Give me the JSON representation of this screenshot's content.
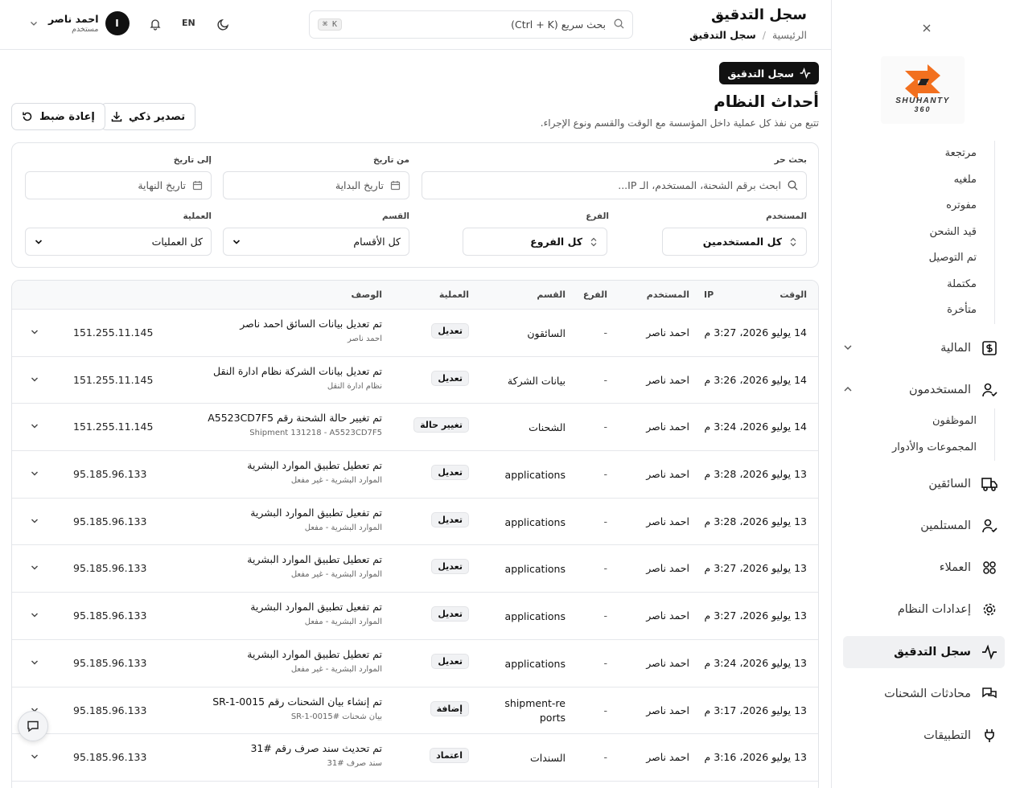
{
  "colors": {
    "accent": "#111111",
    "logo_orange": "#f2701f"
  },
  "sidebar": {
    "close_icon": "close-icon",
    "logo_text_line1": "SHUHANTY",
    "logo_text_line2": "360",
    "shipment_statuses": [
      "مرتجعة",
      "ملغيه",
      "مفوتره",
      "قيد الشحن",
      "تم التوصيل",
      "مكتملة",
      "متأخرة"
    ],
    "finance_label": "المالية",
    "users_label": "المستخدمون",
    "users_sub": [
      "الموظفون",
      "المجموعات والأدوار"
    ],
    "drivers_label": "السائقين",
    "receivers_label": "المستلمين",
    "clients_label": "العملاء",
    "settings_label": "إعدادات النظام",
    "audit_label": "سجل التدقيق",
    "conversations_label": "محادثات الشحنات",
    "apps_label": "التطبيقات"
  },
  "topbar": {
    "title": "سجل التدقيق",
    "breadcrumb_home": "الرئيسية",
    "breadcrumb_sep": "/",
    "breadcrumb_current": "سجل التدقيق",
    "search_placeholder": "بحث سريع (Ctrl + K)",
    "search_kbd": "⌘ K",
    "lang": "EN",
    "user_name": "احمد ناصر",
    "user_role": "مستخدم",
    "user_initial": "I"
  },
  "header": {
    "badge": "سجل التدقيق",
    "title": "أحداث النظام",
    "subtitle": "تتبع من نفذ كل عملية داخل المؤسسة مع الوقت والقسم ونوع الإجراء.",
    "export_label": "تصدير ذكي",
    "reset_label": "إعادة ضبط"
  },
  "filters": {
    "search_label": "بحث حر",
    "search_placeholder": "ابحث برقم الشحنة، المستخدم، الـ IP...",
    "from_label": "من تاريخ",
    "from_placeholder": "تاريخ البداية",
    "to_label": "إلى تاريخ",
    "to_placeholder": "تاريخ النهاية",
    "user_label": "المستخدم",
    "user_value": "كل المستخدمين",
    "branch_label": "الفرع",
    "branch_value": "كل الفروع",
    "dept_label": "القسم",
    "dept_value": "كل الأقسام",
    "op_label": "العملية",
    "op_value": "كل العمليات"
  },
  "table": {
    "headers": {
      "time": "الوقت",
      "user": "المستخدم",
      "branch": "الفرع",
      "dept": "القسم",
      "op": "العملية",
      "desc": "الوصف",
      "ip": "IP"
    },
    "rows": [
      {
        "time": "14 يوليو 2026، 3:27 م",
        "user": "احمد ناصر",
        "branch": "-",
        "dept": "السائقون",
        "op": "تعديل",
        "desc": "تم تعديل بيانات السائق احمد ناصر",
        "sub": "احمد ناصر",
        "ip": "151.255.11.145"
      },
      {
        "time": "14 يوليو 2026، 3:26 م",
        "user": "احمد ناصر",
        "branch": "-",
        "dept": "بيانات الشركة",
        "op": "تعديل",
        "desc": "تم تعديل بيانات الشركة نظام ادارة النقل",
        "sub": "نظام ادارة النقل",
        "ip": "151.255.11.145"
      },
      {
        "time": "14 يوليو 2026، 3:24 م",
        "user": "احمد ناصر",
        "branch": "-",
        "dept": "الشحنات",
        "op": "تغيير حالة",
        "desc": "تم تغيير حالة الشحنة رقم A5523CD7F5",
        "sub": "Shipment 131218 - A5523CD7F5",
        "ip": "151.255.11.145"
      },
      {
        "time": "13 يوليو 2026، 3:28 م",
        "user": "احمد ناصر",
        "branch": "-",
        "dept": "applications",
        "op": "تعديل",
        "desc": "تم تعطيل تطبيق الموارد البشرية",
        "sub": "الموارد البشرية - غير مفعل",
        "ip": "95.185.96.133"
      },
      {
        "time": "13 يوليو 2026، 3:28 م",
        "user": "احمد ناصر",
        "branch": "-",
        "dept": "applications",
        "op": "تعديل",
        "desc": "تم تفعيل تطبيق الموارد البشرية",
        "sub": "الموارد البشرية - مفعل",
        "ip": "95.185.96.133"
      },
      {
        "time": "13 يوليو 2026، 3:27 م",
        "user": "احمد ناصر",
        "branch": "-",
        "dept": "applications",
        "op": "تعديل",
        "desc": "تم تعطيل تطبيق الموارد البشرية",
        "sub": "الموارد البشرية - غير مفعل",
        "ip": "95.185.96.133"
      },
      {
        "time": "13 يوليو 2026، 3:27 م",
        "user": "احمد ناصر",
        "branch": "-",
        "dept": "applications",
        "op": "تعديل",
        "desc": "تم تفعيل تطبيق الموارد البشرية",
        "sub": "الموارد البشرية - مفعل",
        "ip": "95.185.96.133"
      },
      {
        "time": "13 يوليو 2026، 3:24 م",
        "user": "احمد ناصر",
        "branch": "-",
        "dept": "applications",
        "op": "تعديل",
        "desc": "تم تعطيل تطبيق الموارد البشرية",
        "sub": "الموارد البشرية - غير مفعل",
        "ip": "95.185.96.133"
      },
      {
        "time": "13 يوليو 2026، 3:17 م",
        "user": "احمد ناصر",
        "branch": "-",
        "dept": "shipment-reports",
        "op": "إضافة",
        "desc": "تم إنشاء بيان الشحنات رقم SR-1-0015",
        "sub": "بيان شحنات #SR-1-0015",
        "ip": "95.185.96.133"
      },
      {
        "time": "13 يوليو 2026، 3:16 م",
        "user": "احمد ناصر",
        "branch": "-",
        "dept": "السندات",
        "op": "اعتماد",
        "desc": "تم تحديث سند صرف رقم #31",
        "sub": "سند صرف #31",
        "ip": "95.185.96.133"
      }
    ]
  }
}
